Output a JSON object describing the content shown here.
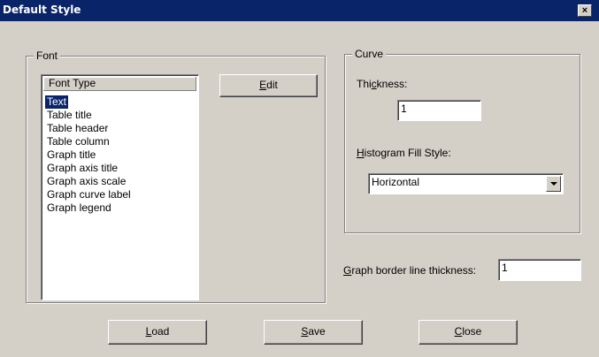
{
  "window": {
    "title": "Default Style",
    "close_glyph": "×",
    "close_icon": "close-icon"
  },
  "font_group": {
    "legend": "Font",
    "list_header": "Font Type",
    "items": [
      "Text",
      "Table title",
      "Table header",
      "Table column",
      "Graph title",
      "Graph axis title",
      "Graph axis scale",
      "Graph curve label",
      "Graph legend"
    ],
    "selected_index": 0,
    "edit_button": {
      "mnemonic": "E",
      "rest": "dit"
    }
  },
  "curve_group": {
    "legend": "Curve",
    "thickness_label": {
      "pre": "Thi",
      "mnemonic": "c",
      "rest": "kness:"
    },
    "thickness_value": "1",
    "fill_label": {
      "mnemonic": "H",
      "rest": "istogram Fill Style:"
    },
    "fill_value": "Horizontal",
    "dropdown_icon": "chevron-down-icon"
  },
  "border": {
    "label": {
      "mnemonic": "G",
      "rest": "raph border line thickness:"
    },
    "value": "1"
  },
  "buttons": {
    "load": {
      "mnemonic": "L",
      "rest": "oad"
    },
    "save": {
      "mnemonic": "S",
      "rest": "ave"
    },
    "close": {
      "mnemonic": "C",
      "rest": "lose"
    }
  }
}
